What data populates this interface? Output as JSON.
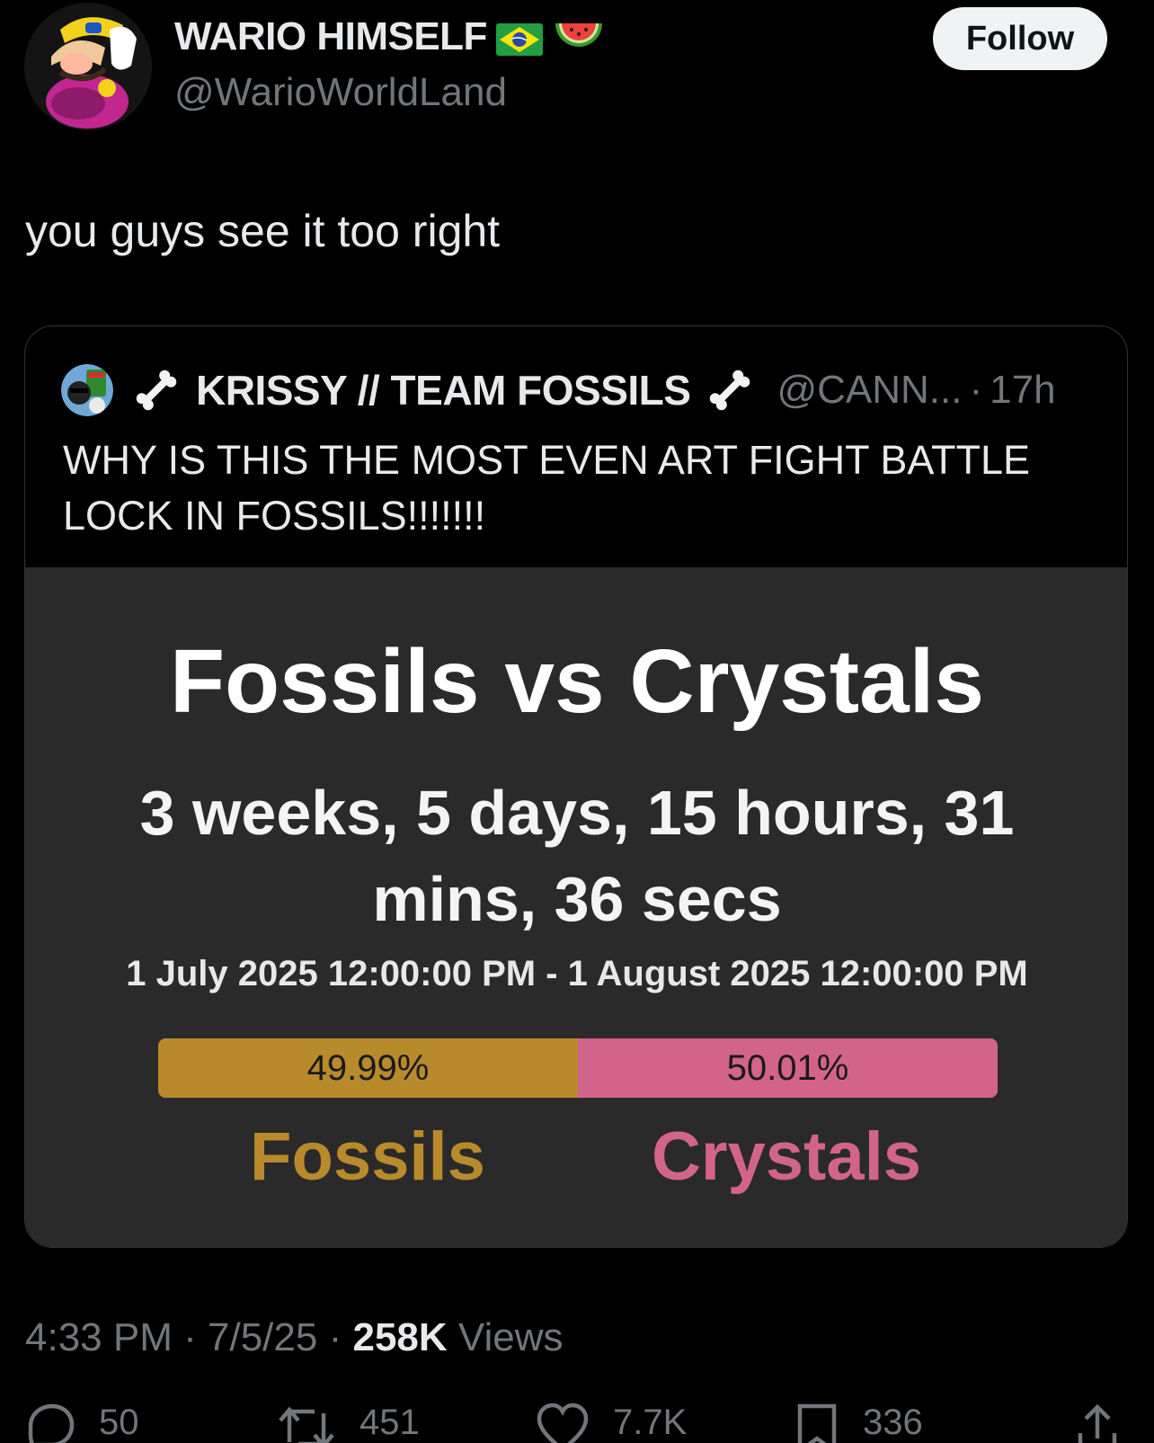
{
  "author": {
    "name": "WARIO HIMSELF",
    "handle": "@WarioWorldLand",
    "name_emojis": [
      "brazil-flag-icon",
      "watermelon-icon"
    ]
  },
  "follow_label": "Follow",
  "tweet": {
    "text": "you guys see it too right"
  },
  "quote": {
    "name": "KRISSY // TEAM FOSSILS",
    "handle": "@CANN...",
    "separator": "·",
    "time": "17h",
    "text": "WHY IS THIS THE MOST EVEN ART FIGHT BATTLE LOCK IN FOSSILS!!!!!!!",
    "media": {
      "title": "Fossils vs Crystals",
      "countdown": "3 weeks, 5 days, 15 hours, 31 mins, 36 secs",
      "range": "1 July 2025 12:00:00 PM - 1 August 2025 12:00:00 PM",
      "fossils_label": "Fossils",
      "crystals_label": "Crystals",
      "fossils_pct_text": "49.99%",
      "crystals_pct_text": "50.01%",
      "fossils_share": 0.4999,
      "colors": {
        "fossils": "#b98a2b",
        "crystals": "#d36489"
      }
    }
  },
  "meta": {
    "time": "4:33 PM",
    "sep1": "·",
    "date": "7/5/25",
    "sep2": "·",
    "views_count": "258K",
    "views_label": "Views"
  },
  "actions": {
    "replies": "50",
    "reposts": "451",
    "likes": "7.7K",
    "bookmarks": "336"
  }
}
